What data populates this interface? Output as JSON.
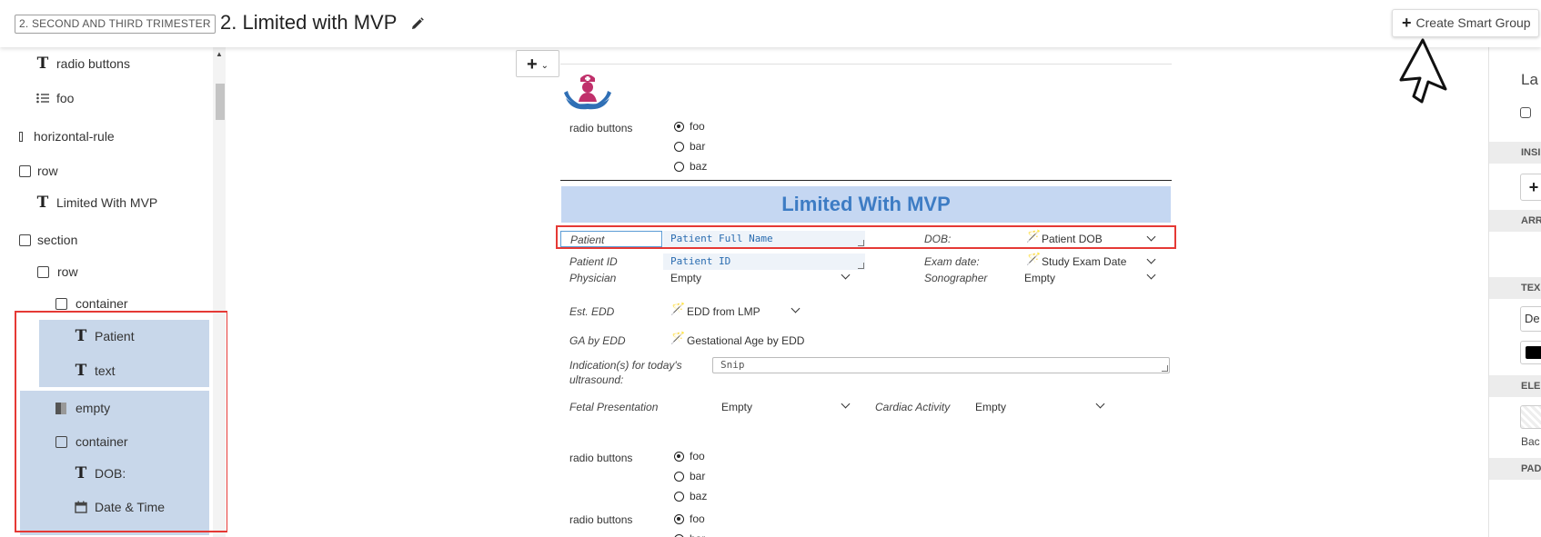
{
  "header": {
    "breadcrumb": "2. SECOND AND THIRD TRIMESTER",
    "title": "2. Limited with MVP",
    "smart_group_label": "Create Smart Group"
  },
  "tree": {
    "items": [
      {
        "label": "radio buttons",
        "icon": "text-icon"
      },
      {
        "label": "foo",
        "icon": "list-icon"
      },
      {
        "label": "horizontal-rule",
        "icon": "rule-icon"
      },
      {
        "label": "row",
        "icon": "box-icon"
      },
      {
        "label": "Limited With MVP",
        "icon": "text-icon"
      },
      {
        "label": "section",
        "icon": "box-icon"
      },
      {
        "label": "row",
        "icon": "box-icon"
      },
      {
        "label": "container",
        "icon": "box-icon"
      },
      {
        "label": "Patient",
        "icon": "text-icon"
      },
      {
        "label": "text",
        "icon": "text-icon"
      },
      {
        "label": "empty",
        "icon": "empty-icon"
      },
      {
        "label": "container",
        "icon": "box-icon"
      },
      {
        "label": "DOB:",
        "icon": "text-icon"
      },
      {
        "label": "Date & Time",
        "icon": "calendar-icon"
      }
    ]
  },
  "form": {
    "radio1": {
      "label": "radio buttons",
      "options": [
        "foo",
        "bar",
        "baz"
      ],
      "selected": 0
    },
    "banner": "Limited With MVP",
    "patient_label": "Patient",
    "patient_value": "Patient Full Name",
    "dob_label": "DOB:",
    "dob_value": "Patient DOB",
    "patient_id_label": "Patient ID",
    "patient_id_value": "Patient ID",
    "exam_date_label": "Exam date:",
    "exam_date_value": "Study Exam Date",
    "physician_label": "Physician",
    "physician_value": "Empty",
    "sonographer_label": "Sonographer",
    "sonographer_value": "Empty",
    "edd_label": "Est. EDD",
    "edd_value": "EDD from LMP",
    "ga_label": "GA by EDD",
    "ga_value": "Gestational Age by EDD",
    "indication_label_1": "Indication(s) for today's",
    "indication_label_2": "ultrasound:",
    "indication_value": "Snip",
    "fetal_label": "Fetal Presentation",
    "fetal_value": "Empty",
    "cardiac_label": "Cardiac Activity",
    "cardiac_value": "Empty",
    "radio2": {
      "label": "radio buttons",
      "options": [
        "foo",
        "bar",
        "baz"
      ],
      "selected": 0
    },
    "radio3": {
      "label": "radio buttons",
      "options": [
        "foo",
        "bar"
      ],
      "selected": 0
    }
  },
  "right_panel": {
    "heading": "La",
    "sections": [
      "INSI",
      "ARR",
      "TEX",
      "ELE",
      "PAD"
    ],
    "font_value": "De",
    "bg_label": "Bac"
  },
  "colors": {
    "accent_blue": "#3d7cc4",
    "banner_bg": "#c5d7f2",
    "selection_bg": "#c8d7ea",
    "highlight_red": "#e53935"
  }
}
